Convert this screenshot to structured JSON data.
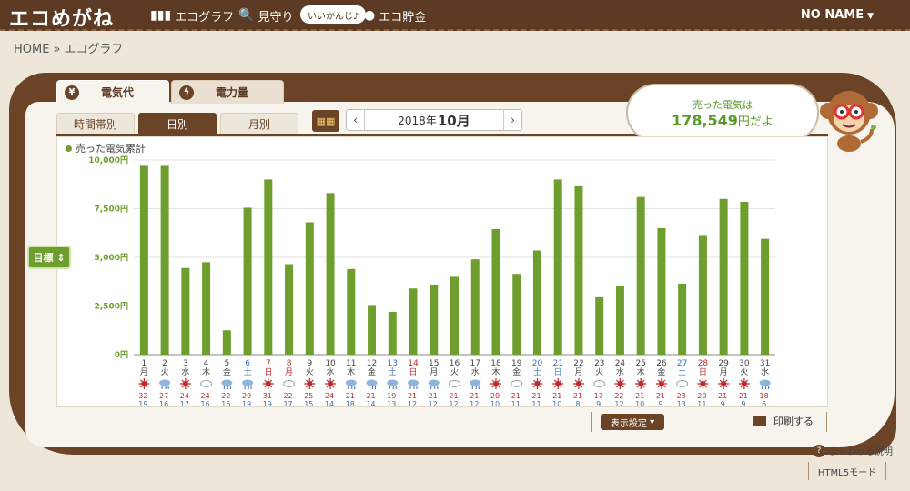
{
  "header": {
    "brand": "エコめがね",
    "nav": {
      "graph": "エコグラフ",
      "mimamori": "見守り",
      "badge": "いいかんじ♪",
      "savings": "エコ貯金"
    },
    "user": "NO NAME"
  },
  "breadcrumb": {
    "home": "HOME",
    "sep": "»",
    "current": "エコグラフ"
  },
  "tabs": {
    "main": [
      {
        "label": "電気代",
        "icon": "yen-icon",
        "active": true
      },
      {
        "label": "電力量",
        "icon": "lightning-icon",
        "active": false
      }
    ],
    "sub": [
      {
        "label": "時間帯別",
        "active": false
      },
      {
        "label": "日別",
        "active": true
      },
      {
        "label": "月別",
        "active": false
      }
    ]
  },
  "date_nav": {
    "prev": "‹",
    "year_text": "2018年",
    "month_text": "10月",
    "next": "›"
  },
  "speech": {
    "line1": "売った電気は",
    "amount": "178,549",
    "suffix": "円だよ"
  },
  "target_button": "目標",
  "footer": {
    "display_settings": "表示設定",
    "print": "印刷する",
    "help": "よくわかる説明",
    "html5": "HTML5モード"
  },
  "colors": {
    "bar": "#6e9e2e",
    "wood": "#6b4326",
    "red_day": "#c0282d",
    "blue_day": "#3a6fc2",
    "hi_temp": "#c0282d",
    "lo_temp": "#3a6fc2"
  },
  "chart_data": {
    "type": "bar",
    "legend": "売った電気累計",
    "ylim": [
      0,
      10000
    ],
    "yticks": [
      "0円",
      "2,500円",
      "5,000円",
      "7,500円",
      "10,000円"
    ],
    "ytick_values": [
      0,
      2500,
      5000,
      7500,
      10000
    ],
    "grid": true,
    "days": [
      {
        "d": "1",
        "w": "月",
        "v": 9700,
        "wx": "sun",
        "hi": "32",
        "lo": "19"
      },
      {
        "d": "2",
        "w": "火",
        "v": 9700,
        "wx": "rain",
        "hi": "27",
        "lo": "16"
      },
      {
        "d": "3",
        "w": "水",
        "v": 4450,
        "wx": "sun",
        "hi": "24",
        "lo": "17"
      },
      {
        "d": "4",
        "w": "木",
        "v": 4750,
        "wx": "cloud",
        "hi": "24",
        "lo": "16"
      },
      {
        "d": "5",
        "w": "金",
        "v": 1250,
        "wx": "rain",
        "hi": "22",
        "lo": "16"
      },
      {
        "d": "6",
        "w": "土",
        "v": 7550,
        "wx": "rain",
        "hi": "29",
        "lo": "19"
      },
      {
        "d": "7",
        "w": "日",
        "v": 9000,
        "wx": "sun",
        "hi": "31",
        "lo": "19"
      },
      {
        "d": "8",
        "w": "月",
        "v": 4650,
        "wx": "cloud",
        "hi": "22",
        "lo": "17"
      },
      {
        "d": "9",
        "w": "火",
        "v": 6800,
        "wx": "sun",
        "hi": "25",
        "lo": "15"
      },
      {
        "d": "10",
        "w": "水",
        "v": 8300,
        "wx": "sun",
        "hi": "24",
        "lo": "14"
      },
      {
        "d": "11",
        "w": "木",
        "v": 4400,
        "wx": "rain",
        "hi": "21",
        "lo": "18"
      },
      {
        "d": "12",
        "w": "金",
        "v": 2550,
        "wx": "rain",
        "hi": "21",
        "lo": "14"
      },
      {
        "d": "13",
        "w": "土",
        "v": 2200,
        "wx": "rain",
        "hi": "19",
        "lo": "13"
      },
      {
        "d": "14",
        "w": "日",
        "v": 3400,
        "wx": "rain",
        "hi": "21",
        "lo": "12"
      },
      {
        "d": "15",
        "w": "月",
        "v": 3600,
        "wx": "rain",
        "hi": "21",
        "lo": "12"
      },
      {
        "d": "16",
        "w": "火",
        "v": 4000,
        "wx": "cloud",
        "hi": "21",
        "lo": "12"
      },
      {
        "d": "17",
        "w": "水",
        "v": 4900,
        "wx": "rain",
        "hi": "21",
        "lo": "12"
      },
      {
        "d": "18",
        "w": "木",
        "v": 6450,
        "wx": "sun",
        "hi": "20",
        "lo": "10"
      },
      {
        "d": "19",
        "w": "金",
        "v": 4150,
        "wx": "cloud",
        "hi": "21",
        "lo": "11"
      },
      {
        "d": "20",
        "w": "土",
        "v": 5350,
        "wx": "sun",
        "hi": "21",
        "lo": "11"
      },
      {
        "d": "21",
        "w": "日",
        "v": 9000,
        "wx": "sun",
        "hi": "21",
        "lo": "10"
      },
      {
        "d": "22",
        "w": "月",
        "v": 8650,
        "wx": "sun",
        "hi": "21",
        "lo": "8"
      },
      {
        "d": "23",
        "w": "火",
        "v": 2950,
        "wx": "cloud",
        "hi": "17",
        "lo": "9"
      },
      {
        "d": "24",
        "w": "水",
        "v": 3550,
        "wx": "sun",
        "hi": "22",
        "lo": "12"
      },
      {
        "d": "25",
        "w": "木",
        "v": 8100,
        "wx": "sun",
        "hi": "21",
        "lo": "10"
      },
      {
        "d": "26",
        "w": "金",
        "v": 6500,
        "wx": "sun",
        "hi": "21",
        "lo": "9"
      },
      {
        "d": "27",
        "w": "土",
        "v": 3650,
        "wx": "cloud",
        "hi": "23",
        "lo": "13"
      },
      {
        "d": "28",
        "w": "日",
        "v": 6100,
        "wx": "sun",
        "hi": "20",
        "lo": "11"
      },
      {
        "d": "29",
        "w": "月",
        "v": 8000,
        "wx": "sun",
        "hi": "21",
        "lo": "9"
      },
      {
        "d": "30",
        "w": "火",
        "v": 7850,
        "wx": "sun",
        "hi": "21",
        "lo": "9"
      },
      {
        "d": "31",
        "w": "水",
        "v": 5950,
        "wx": "rain",
        "hi": "18",
        "lo": "6"
      }
    ],
    "day_colors": {
      "6": "blue",
      "7": "red",
      "8": "red",
      "13": "blue",
      "14": "red",
      "20": "blue",
      "21": "blue",
      "27": "blue",
      "28": "red"
    }
  }
}
